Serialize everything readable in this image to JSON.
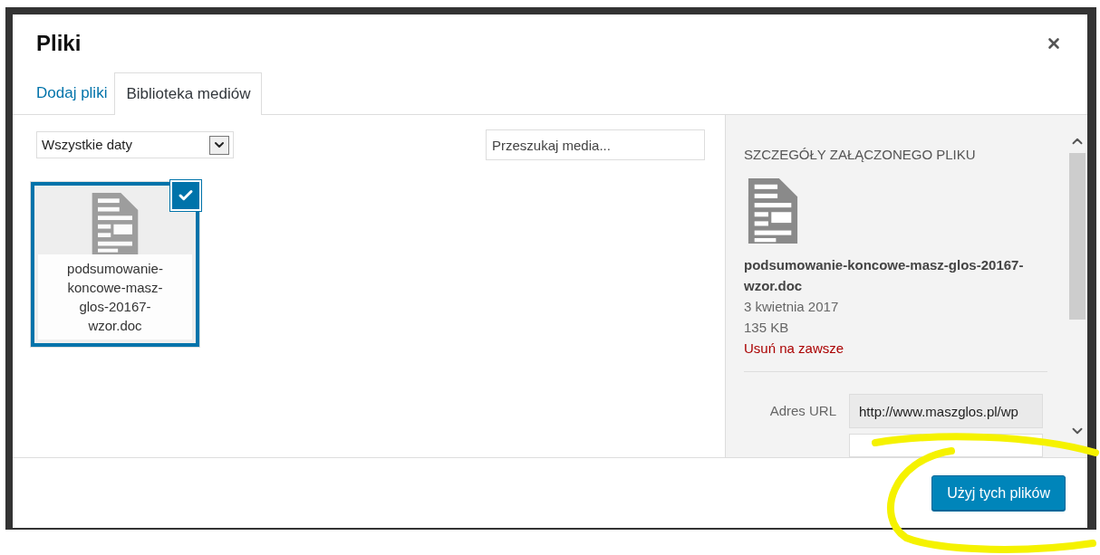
{
  "modal": {
    "title": "Pliki"
  },
  "tabs": [
    {
      "label": "Dodaj pliki",
      "selected": false
    },
    {
      "label": "Biblioteka mediów",
      "selected": true
    }
  ],
  "filter": {
    "value": "Wszystkie daty"
  },
  "search": {
    "placeholder": "Przeszukaj media..."
  },
  "attachments": [
    {
      "filename": "podsumowanie-koncowe-masz-glos-20167-wzor.doc",
      "selected": true
    }
  ],
  "details": {
    "heading": "SZCZEGÓŁY ZAŁĄCZONEGO PLIKU",
    "filename": "podsumowanie-koncowe-masz-glos-20167-wzor.doc",
    "date": "3 kwietnia 2017",
    "size": "135 KB",
    "delete_link": "Usuń na zawsze",
    "fields": [
      {
        "label": "Adres URL",
        "value": "http://www.maszglos.pl/wp"
      }
    ]
  },
  "footer": {
    "button": "Użyj tych plików"
  }
}
